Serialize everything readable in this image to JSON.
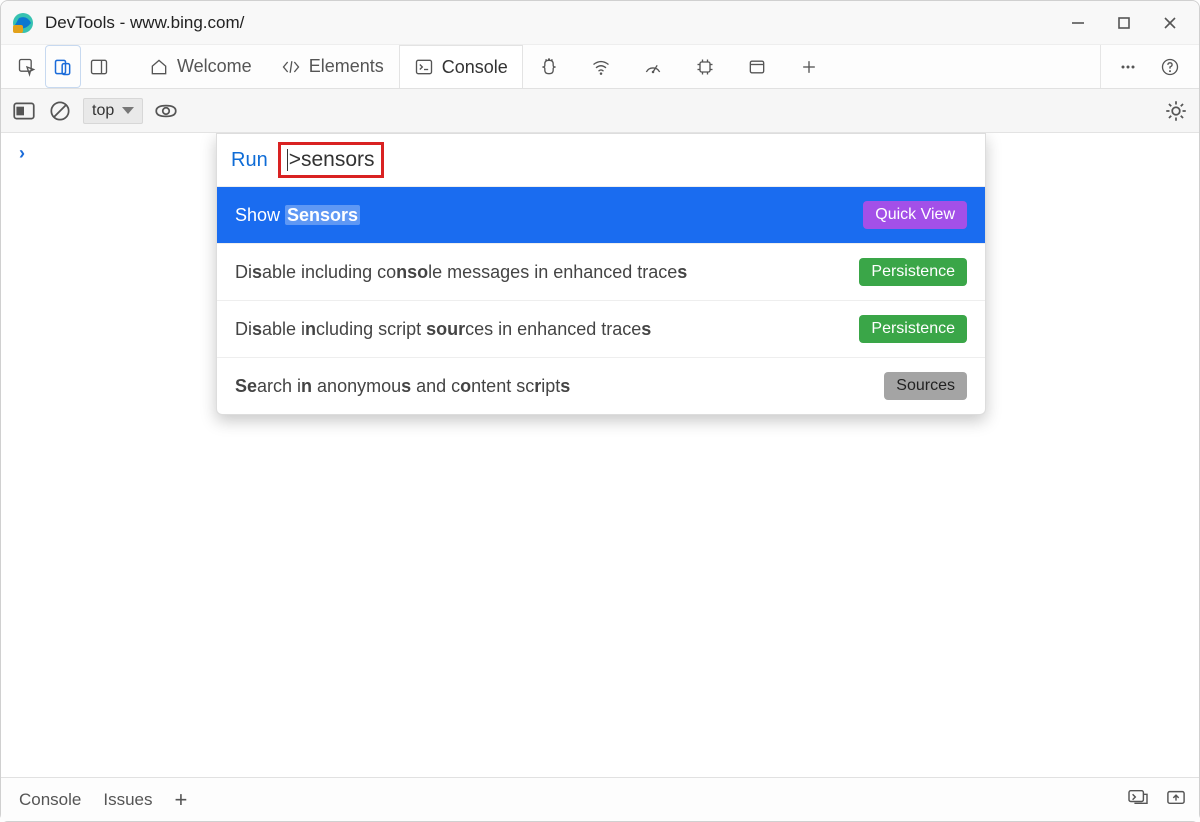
{
  "window": {
    "title": "DevTools - www.bing.com/"
  },
  "tabs": {
    "welcome": "Welcome",
    "elements": "Elements",
    "console": "Console"
  },
  "console_toolbar": {
    "context": "top"
  },
  "command_menu": {
    "run_label": "Run",
    "query_caret": ">",
    "query": "sensors",
    "items": [
      {
        "html": "Show <b class='match'>Sensors</b>",
        "badge": "Quick View",
        "badge_class": "badge-quick",
        "selected": true
      },
      {
        "html": "Di<b>s</b>able including co<b>nso</b>le messages in enhanced trace<b>s</b>",
        "badge": "Persistence",
        "badge_class": "badge-persist",
        "selected": false
      },
      {
        "html": "Di<b>s</b>able i<b>n</b>cluding script <b>sour</b>ces in enhanced trace<b>s</b>",
        "badge": "Persistence",
        "badge_class": "badge-persist",
        "selected": false
      },
      {
        "html": "<b>Se</b>arch i<b>n</b> anonymou<b>s</b> and c<b>o</b>ntent sc<b>r</b>ipt<b>s</b>",
        "badge": "Sources",
        "badge_class": "badge-sources",
        "selected": false
      }
    ]
  },
  "drawer": {
    "console": "Console",
    "issues": "Issues"
  }
}
